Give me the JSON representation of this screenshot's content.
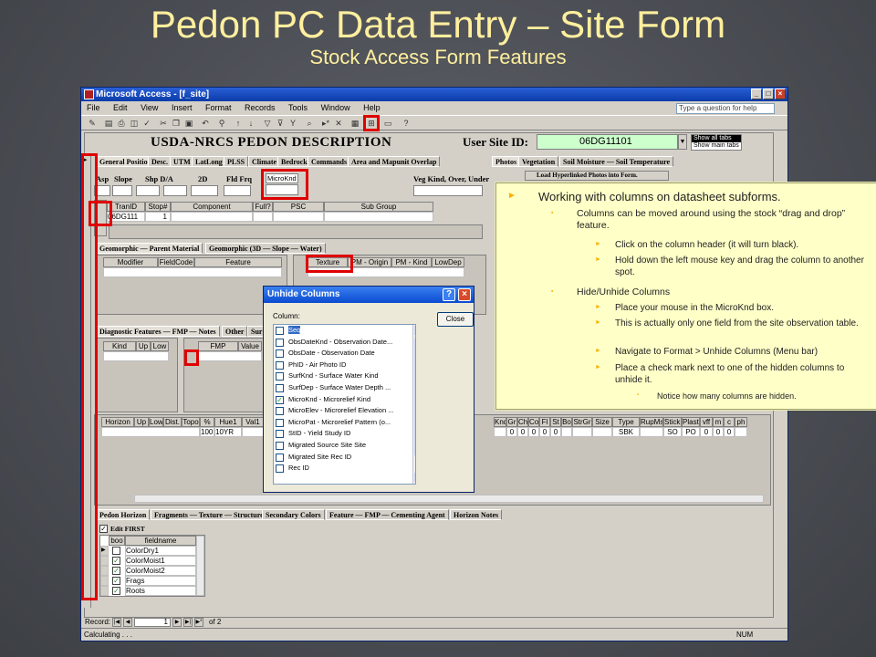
{
  "slide": {
    "title": "Pedon PC Data Entry – Site Form",
    "subtitle": "Stock Access Form Features"
  },
  "window": {
    "title": "Microsoft Access - [f_site]",
    "menu": [
      "File",
      "Edit",
      "View",
      "Insert",
      "Format",
      "Records",
      "Tools",
      "Window",
      "Help"
    ],
    "help_placeholder": "Type a question for help"
  },
  "form": {
    "header_title": "USDA-NRCS PEDON DESCRIPTION",
    "user_site_label": "User Site ID:",
    "user_site_id": "06DG11101",
    "tab_selector": [
      "Show all tabs",
      "Show main tabs"
    ],
    "top_tabs": [
      "General Position",
      "Desc.",
      "UTM",
      "LatLong",
      "PLSS",
      "Climate",
      "Bedrock",
      "Commands",
      "Area and Mapunit Overlap"
    ],
    "right_tabs": [
      "Photos",
      "Vegetation",
      "Soil Moisture — Soil Temperature"
    ],
    "photos_button": "Load Hyperlinked Photos into Form.",
    "position_labels": [
      "Asp",
      "Slope",
      "Shp D/A",
      "2D",
      "Fld Frq",
      "MicroKnd"
    ],
    "veg_label": "Veg Kind, Over, Under",
    "tran_headers": [
      "TranID",
      "Stop#",
      "Component",
      "Full?",
      "PSC",
      "Sub Group"
    ],
    "tran_row": [
      "06DG111",
      "1",
      "",
      "",
      "",
      ""
    ],
    "geo_tabs": [
      "Geomorphic — Parent Material",
      "Geomorphic (3D — Slope — Water)"
    ],
    "geo_headers": [
      "Modifier",
      "FieldCode",
      "Feature"
    ],
    "pm_headers": [
      "Texture",
      "PM - Origin",
      "PM - Kind",
      "LowDep"
    ],
    "diag_tabs": [
      "Diagnostic Features — FMP — Notes",
      "Other",
      "Sur"
    ],
    "diag_headers": [
      "Kind",
      "Up",
      "Low"
    ],
    "fmp_headers": [
      "FMP",
      "Value"
    ],
    "horizon_headers": [
      "Horizon",
      "Up",
      "Low",
      "Dist.",
      "Topo",
      "%",
      "Hue1",
      "Val1"
    ],
    "horizon_row": [
      "",
      "",
      "",
      "",
      "",
      "100",
      "10YR",
      ""
    ],
    "horizon_right_headers": [
      "Knd",
      "Gr",
      "Ch",
      "Co",
      "Fl",
      "St",
      "Bo",
      "StrGr",
      "Size",
      "Type",
      "RupMst",
      "Stick.",
      "Plast.",
      "vff",
      "m",
      "c",
      "ph"
    ],
    "horizon_right_row": [
      "",
      "0",
      "0",
      "0",
      "0",
      "0",
      "",
      "",
      "",
      "SBK",
      "",
      "SO",
      "PO",
      "0",
      "0",
      "0",
      ""
    ],
    "bottom_tabs": [
      "Pedon Horizon",
      "Fragments — Texture — Structure",
      "Secondary Colors",
      "Feature — FMP — Cementing Agent",
      "Horizon Notes"
    ],
    "edit_first": "Edit FIRST",
    "bottom_headers": [
      "boo",
      "fieldname"
    ],
    "bottom_rows": [
      {
        "checked": false,
        "name": "ColorDry1"
      },
      {
        "checked": true,
        "name": "ColorMoist1"
      },
      {
        "checked": true,
        "name": "ColorMoist2"
      },
      {
        "checked": true,
        "name": "Frags"
      },
      {
        "checked": true,
        "name": "Roots"
      }
    ],
    "record_label": "Record:",
    "record_value": "1",
    "record_of": "of 2",
    "status_left": "Calculating . . .",
    "status_right": "NUM"
  },
  "dialog": {
    "title": "Unhide Columns",
    "column_label": "Column:",
    "close_label": "Close",
    "items": [
      {
        "checked": false,
        "label": "Seq",
        "selected": true
      },
      {
        "checked": false,
        "label": "ObsDateKnd - Observation Date..."
      },
      {
        "checked": false,
        "label": "ObsDate - Observation Date"
      },
      {
        "checked": false,
        "label": "PhID - Air Photo ID"
      },
      {
        "checked": false,
        "label": "SurfKnd - Surface Water Kind"
      },
      {
        "checked": false,
        "label": "SurfDep - Surface Water Depth ..."
      },
      {
        "checked": true,
        "label": "MicroKnd - Microrelief Kind"
      },
      {
        "checked": false,
        "label": "MicroElev - Microrelief Elevation ..."
      },
      {
        "checked": false,
        "label": "MicroPat - Microrelief Pattern (o..."
      },
      {
        "checked": false,
        "label": "StID - Yield Study ID"
      },
      {
        "checked": false,
        "label": "Migrated Source Site Site"
      },
      {
        "checked": false,
        "label": "Migrated Site Rec ID"
      },
      {
        "checked": false,
        "label": "Rec ID"
      }
    ]
  },
  "note": {
    "l1": "Working with columns on datasheet subforms.",
    "s1": "Columns can be moved around using the stock “drag and drop” feature.",
    "s1a": "Click on the column header (it will turn black).",
    "s1b": "Hold down the left mouse key and drag the column to another spot.",
    "s2": "Hide/Unhide  Columns",
    "s2a": "Place your mouse in the MicroKnd box.",
    "s2b": "This is actually only one field from the site observation table.",
    "s2c": "Navigate to Format > Unhide Columns (Menu bar)",
    "s2d": "Place a check mark next to one of the hidden columns to unhide it.",
    "s2d1": "Notice how many columns are hidden."
  },
  "colors": {
    "slide_bg": "#4b4e54",
    "title": "#ffef9e",
    "highlight": "#e00000",
    "note_bg": "#ffffc8",
    "user_site_bg": "#ccffcc"
  }
}
